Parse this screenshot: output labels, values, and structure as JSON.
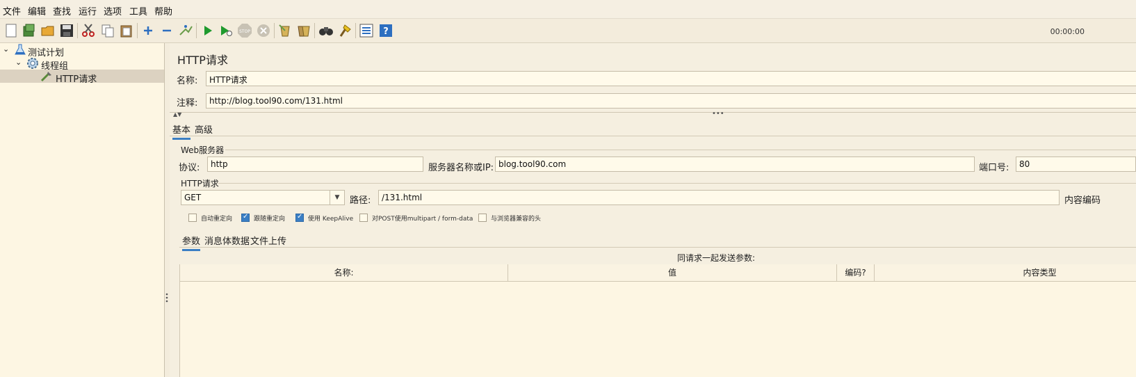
{
  "menubar": {
    "items": [
      "文件",
      "编辑",
      "查找",
      "运行",
      "选项",
      "工具",
      "帮助"
    ]
  },
  "toolbar": {
    "icons": [
      "new-icon",
      "templates-icon",
      "open-icon",
      "save-icon",
      "cut-icon",
      "copy-icon",
      "paste-icon",
      "expand-icon",
      "collapse-icon",
      "toggle-icon",
      "start-icon",
      "start-no-pause-icon",
      "stop-icon",
      "shutdown-icon",
      "clear-icon",
      "clear-all-icon",
      "search-icon",
      "reset-search-icon",
      "function-helper-icon",
      "help-icon"
    ],
    "timer": "00:00:00"
  },
  "tree": {
    "items": [
      {
        "label": "测试计划",
        "icon": "flask-icon",
        "expanded": true
      },
      {
        "label": "线程组",
        "icon": "gear-icon",
        "expanded": true
      },
      {
        "label": "HTTP请求",
        "icon": "pipette-icon",
        "selected": true
      }
    ]
  },
  "main": {
    "title": "HTTP请求",
    "name_label": "名称:",
    "name_value": "HTTP请求",
    "comment_label": "注释:",
    "comment_value": "http://blog.tool90.com/131.html",
    "tabs": [
      {
        "label": "基本",
        "active": true
      },
      {
        "label": "高级",
        "active": false
      }
    ],
    "web_server": {
      "legend": "Web服务器",
      "protocol_label": "协议:",
      "protocol_value": "http",
      "server_label": "服务器名称或IP:",
      "server_value": "blog.tool90.com",
      "port_label": "端口号:",
      "port_value": "80"
    },
    "http_request": {
      "legend": "HTTP请求",
      "method": "GET",
      "path_label": "路径:",
      "path_value": "/131.html",
      "encoding_label": "内容编码"
    },
    "checkboxes": [
      {
        "label": "自动重定向",
        "checked": false
      },
      {
        "label": "跟随重定向",
        "checked": true
      },
      {
        "label": "使用 KeepAlive",
        "checked": true
      },
      {
        "label": "对POST使用multipart / form-data",
        "checked": false
      },
      {
        "label": "与浏览器兼容的头",
        "checked": false
      }
    ],
    "subtabs": [
      {
        "label": "参数",
        "active": true
      },
      {
        "label": "消息体数据",
        "active": false
      },
      {
        "label": "文件上传",
        "active": false
      }
    ],
    "params_caption": "同请求一起发送参数:",
    "table": {
      "columns": [
        "名称:",
        "值",
        "编码?",
        "内容类型"
      ],
      "rows": []
    }
  },
  "colors": {
    "accent": "#3b7fc4",
    "background": "#f3ecdc",
    "field": "#fffaea"
  }
}
